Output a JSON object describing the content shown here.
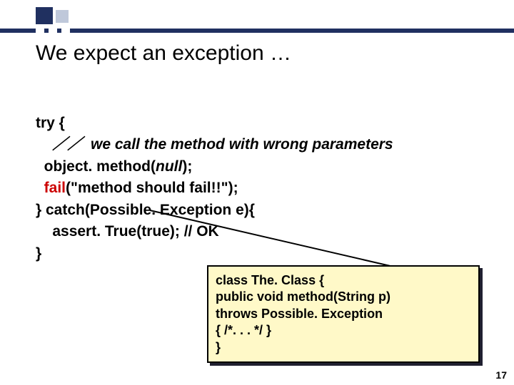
{
  "title": "We expect an exception …",
  "code": {
    "l1": "try {",
    "l2_pre": "    ／／  we call the method with wrong parameters",
    "l3_pre": "  object. method(",
    "l3_null": "null",
    "l3_post": ");",
    "l4_pre": "  ",
    "l4_fail": "fail",
    "l4_post": "(\"method should fail!!\");",
    "l5": "} catch(Possible. Exception e){",
    "l6": "    assert. True(true); // OK",
    "l7": "}"
  },
  "callout": {
    "l1": "class The. Class {",
    "l2": " public void method(String p)",
    "l3": "              throws Possible. Exception",
    "l4": "   { /*. . . */ }",
    "l5": "}"
  },
  "page_number": "17"
}
